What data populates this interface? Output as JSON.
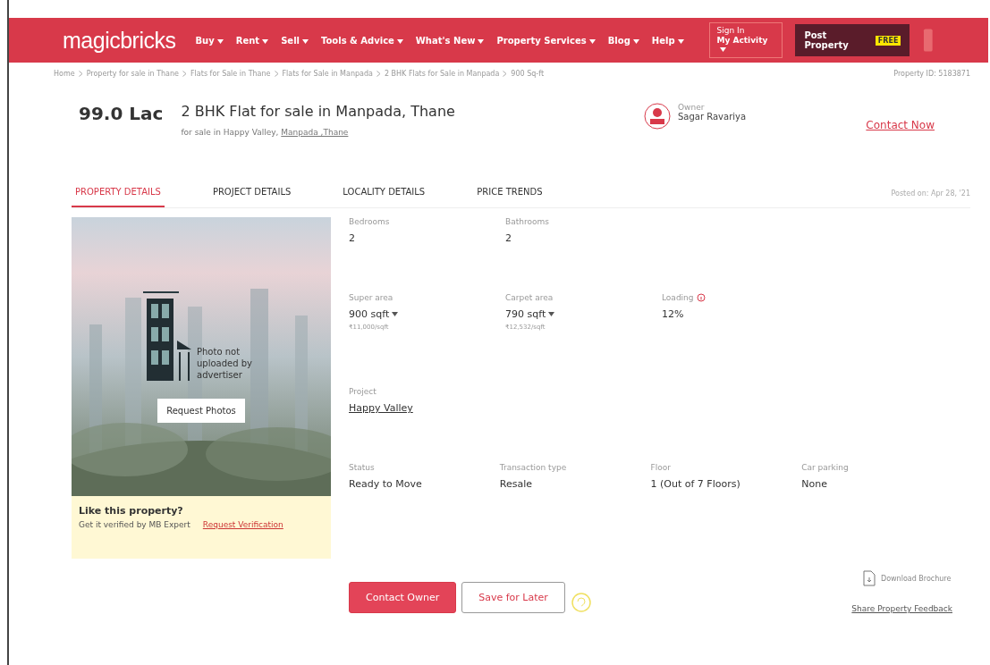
{
  "header": {
    "logo": "magicbricks",
    "nav": [
      {
        "label": "Buy"
      },
      {
        "label": "Rent"
      },
      {
        "label": "Sell"
      },
      {
        "label": "Tools & Advice"
      },
      {
        "label": "What's New"
      },
      {
        "label": "Property Services"
      },
      {
        "label": "Blog"
      },
      {
        "label": "Help"
      }
    ],
    "sign_in": {
      "top": "Sign In",
      "bottom": "My Activity"
    },
    "post": {
      "label": "Post Property",
      "badge": "FREE"
    }
  },
  "breadcrumb": [
    "Home",
    "Property for sale in Thane",
    "Flats for Sale in Thane",
    "Flats for Sale in Manpada",
    "2 BHK Flats for Sale in Manpada",
    "900 Sq-ft"
  ],
  "property_id": "Property ID: 5183871",
  "listing": {
    "price": "99.0 Lac",
    "title": "2 BHK Flat for sale in Manpada, Thane",
    "subtitle": "for sale in Happy Valley,",
    "location_link": "Manpada ,Thane"
  },
  "owner": {
    "role": "Owner",
    "name": "Sagar Ravariya",
    "contact": "Contact Now"
  },
  "tabs": [
    {
      "label": "PROPERTY DETAILS",
      "selected": true
    },
    {
      "label": "PROJECT DETAILS",
      "selected": false
    },
    {
      "label": "LOCALITY DETAILS",
      "selected": false
    },
    {
      "label": "PRICE TRENDS",
      "selected": false
    }
  ],
  "posted": "Posted on: Apr 28, '21",
  "photo": {
    "message": "Photo not uploaded by advertiser",
    "button": "Request Photos"
  },
  "verify": {
    "title": "Like this property?",
    "text": "Get it verified by MB Expert",
    "link": "Request Verification"
  },
  "details": [
    [
      {
        "label": "Bedrooms",
        "value": "2"
      },
      {
        "label": "Bathrooms",
        "value": "2"
      }
    ],
    [
      {
        "label": "Super area",
        "value": "900 sqft",
        "dropdown": true,
        "note": "₹11,000/sqft"
      },
      {
        "label": "Carpet area",
        "value": "790 sqft",
        "dropdown": true,
        "note": "₹12,532/sqft"
      },
      {
        "label": "Loading",
        "info": true,
        "value": "12%"
      }
    ],
    [
      {
        "label": "Project",
        "value": "Happy Valley",
        "link": true
      }
    ],
    [
      {
        "label": "Status",
        "value": "Ready to Move"
      },
      {
        "label": "Transaction type",
        "value": "Resale"
      },
      {
        "label": "Floor",
        "value": "1 (Out of 7 Floors)"
      },
      {
        "label": "Car parking",
        "value": "None"
      }
    ]
  ],
  "brochure": "Download Brochure",
  "actions": {
    "primary": "Contact Owner",
    "secondary": "Save for Later"
  },
  "feedback": "Share Property Feedback"
}
